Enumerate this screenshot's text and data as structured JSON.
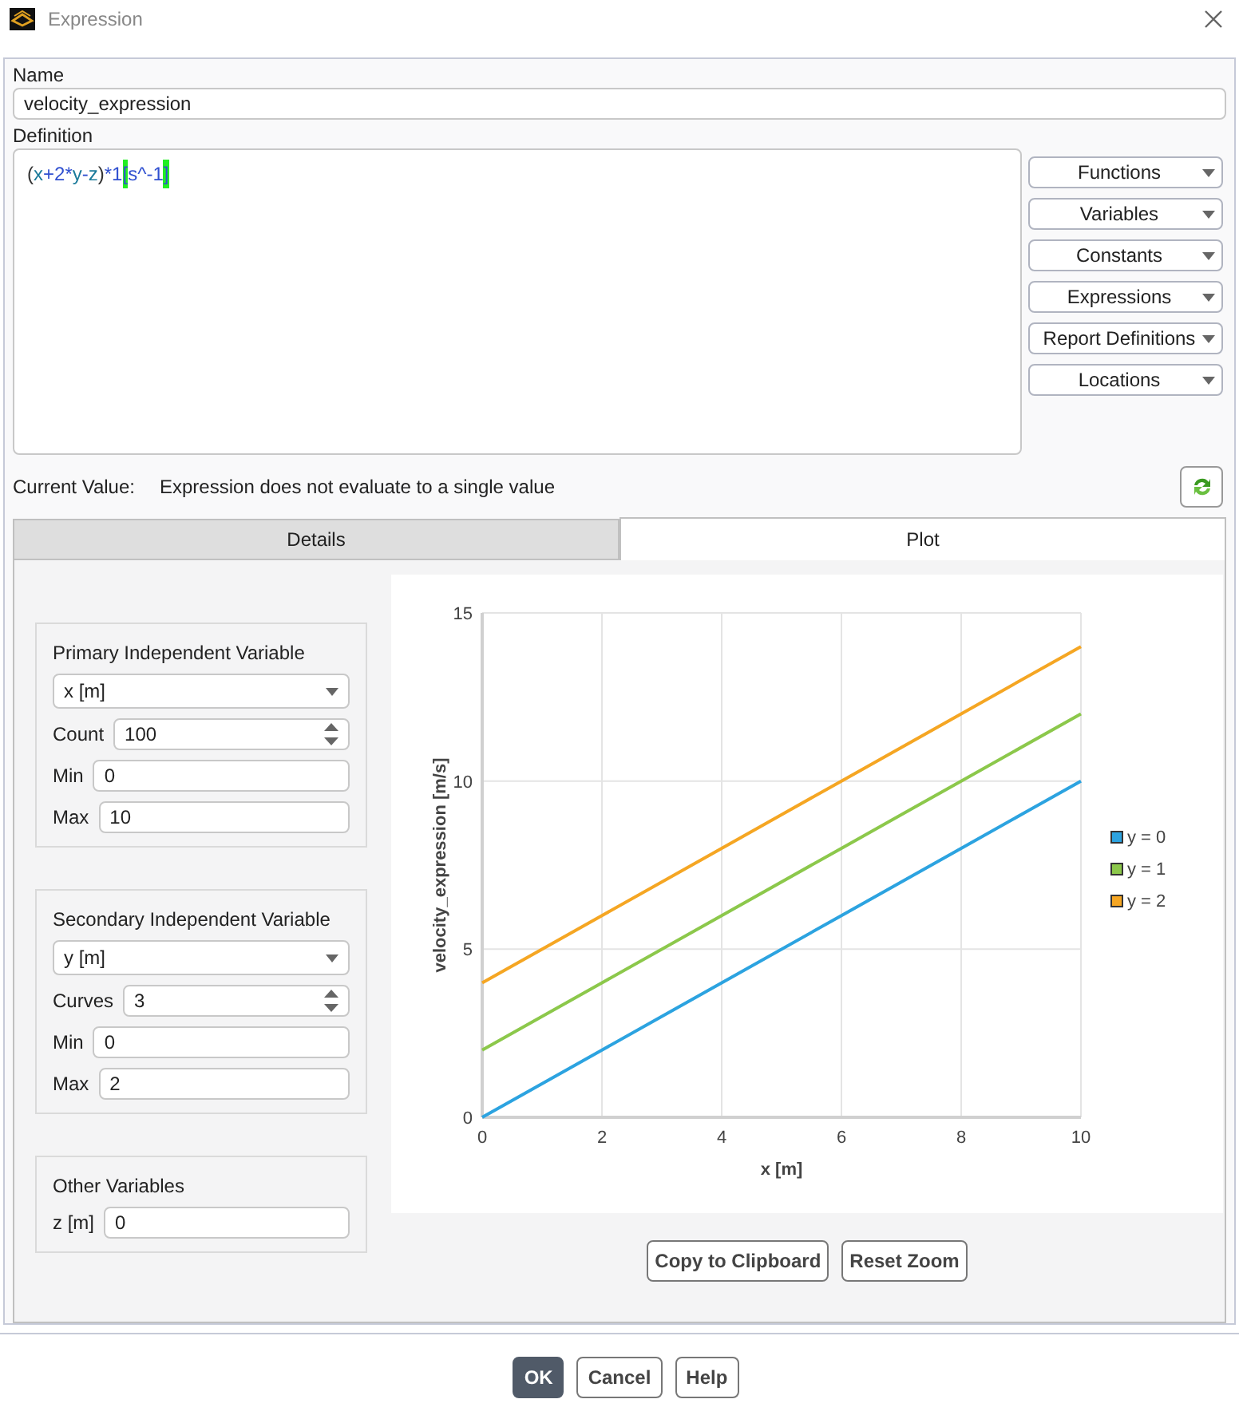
{
  "window": {
    "title": "Expression"
  },
  "name_field": {
    "label": "Name",
    "value": "velocity_expression"
  },
  "definition": {
    "label": "Definition",
    "tokens": [
      {
        "kind": "paren",
        "text": "("
      },
      {
        "kind": "var",
        "text": "x"
      },
      {
        "kind": "op",
        "text": "+"
      },
      {
        "kind": "num",
        "text": "2"
      },
      {
        "kind": "op",
        "text": "*"
      },
      {
        "kind": "var",
        "text": "y"
      },
      {
        "kind": "op",
        "text": "-"
      },
      {
        "kind": "var",
        "text": "z"
      },
      {
        "kind": "paren",
        "text": ")"
      },
      {
        "kind": "op",
        "text": "*"
      },
      {
        "kind": "num",
        "text": "1"
      },
      {
        "kind": "bracket",
        "text": "["
      },
      {
        "kind": "unit",
        "text": "s^-1"
      },
      {
        "kind": "bracket",
        "text": "]"
      }
    ]
  },
  "menu_buttons": [
    "Functions",
    "Variables",
    "Constants",
    "Expressions",
    "Report Definitions",
    "Locations"
  ],
  "current_value": {
    "label": "Current Value:",
    "text": "Expression does not evaluate to a single value"
  },
  "tabs": [
    {
      "label": "Details",
      "selected": false
    },
    {
      "label": "Plot",
      "selected": true
    }
  ],
  "groups": [
    {
      "title": "Primary Independent Variable",
      "fields": [
        {
          "kind": "select",
          "value": "x [m]"
        },
        {
          "kind": "spin",
          "label": "Count",
          "value": "100"
        },
        {
          "kind": "text",
          "label": "Min",
          "value": "0"
        },
        {
          "kind": "text",
          "label": "Max",
          "value": "10"
        }
      ]
    },
    {
      "title": "Secondary Independent Variable",
      "fields": [
        {
          "kind": "select",
          "value": "y [m]"
        },
        {
          "kind": "spin",
          "label": "Curves",
          "value": "3"
        },
        {
          "kind": "text",
          "label": "Min",
          "value": "0"
        },
        {
          "kind": "text",
          "label": "Max",
          "value": "2"
        }
      ]
    },
    {
      "title": "Other Variables",
      "fields": [
        {
          "kind": "text",
          "label": "z [m]",
          "value": "0"
        }
      ]
    }
  ],
  "plot": {
    "chart_data": {
      "type": "line",
      "xlabel": "x [m]",
      "ylabel": "velocity_expression [m/s]",
      "x": [
        0,
        2,
        4,
        6,
        8,
        10
      ],
      "series": [
        {
          "name": "y = 0",
          "color": "#2ca3e0",
          "values": [
            0,
            2,
            4,
            6,
            8,
            10
          ]
        },
        {
          "name": "y = 1",
          "color": "#8cc84b",
          "values": [
            2,
            4,
            6,
            8,
            10,
            12
          ]
        },
        {
          "name": "y = 2",
          "color": "#f5a623",
          "values": [
            4,
            6,
            8,
            10,
            12,
            14
          ]
        }
      ],
      "xlim": [
        0,
        10
      ],
      "ylim": [
        0,
        15
      ],
      "xticks": [
        {
          "value": 0,
          "label": "0"
        },
        {
          "value": 2,
          "label": "2"
        },
        {
          "value": 4,
          "label": "4"
        },
        {
          "value": 6,
          "label": "6"
        },
        {
          "value": 8,
          "label": "8"
        },
        {
          "value": 10,
          "label": "10"
        }
      ],
      "yticks": [
        {
          "value": 0,
          "label": "0"
        },
        {
          "value": 5,
          "label": "5"
        },
        {
          "value": 10,
          "label": "10"
        },
        {
          "value": 15,
          "label": "15"
        }
      ],
      "grid": true,
      "legend": true
    },
    "buttons": [
      "Copy to Clipboard",
      "Reset Zoom"
    ]
  },
  "footer_buttons": [
    {
      "label": "OK",
      "kind": "primary"
    },
    {
      "label": "Cancel",
      "kind": "normal"
    },
    {
      "label": "Help",
      "kind": "normal"
    }
  ]
}
